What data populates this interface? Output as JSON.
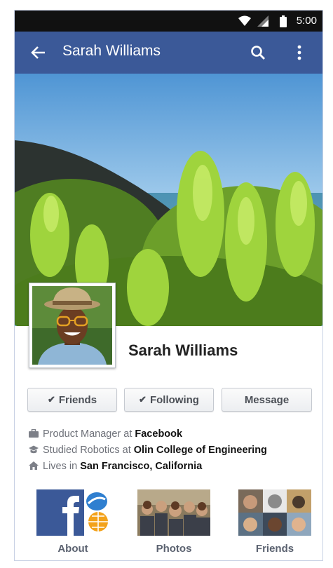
{
  "status_bar": {
    "time": "5:00"
  },
  "app_bar": {
    "title": "Sarah Williams",
    "back_icon": "arrow-left-icon",
    "search_icon": "search-icon",
    "menu_icon": "more-vert-icon"
  },
  "profile": {
    "name": "Sarah Williams"
  },
  "actions": [
    {
      "label": "Friends",
      "checked": true
    },
    {
      "label": "Following",
      "checked": true
    },
    {
      "label": "Message",
      "checked": false
    }
  ],
  "info": [
    {
      "icon": "briefcase-icon",
      "prefix": "Product Manager at",
      "value": "Facebook"
    },
    {
      "icon": "graduation-icon",
      "prefix": "Studied Robotics at",
      "value": "Olin College of Engineering"
    },
    {
      "icon": "home-icon",
      "prefix": "Lives in",
      "value": "San Francisco, California"
    }
  ],
  "tiles": [
    {
      "label": "About"
    },
    {
      "label": "Photos"
    },
    {
      "label": "Friends"
    }
  ],
  "colors": {
    "app_bar": "#3b5998",
    "status_bar": "#111111",
    "facebook_blue": "#3b5998"
  }
}
